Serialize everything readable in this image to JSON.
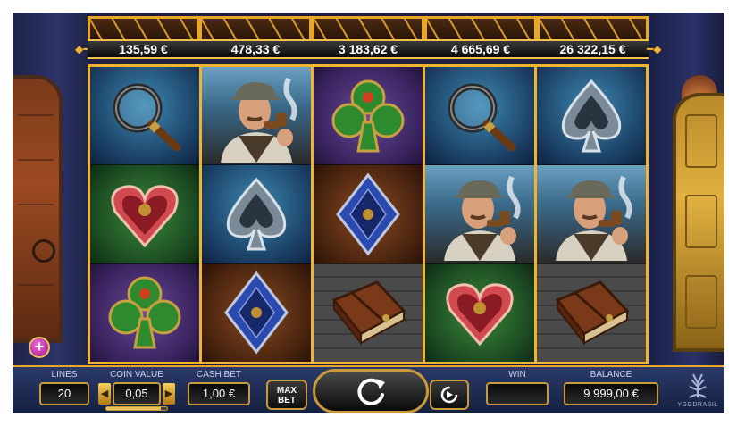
{
  "jackpots": [
    "135,59 €",
    "478,33 €",
    "3 183,62 €",
    "4 665,69 €",
    "26 322,15 €"
  ],
  "reels": [
    [
      {
        "symbol": "magnifying-glass",
        "bg": "blue"
      },
      {
        "symbol": "heart",
        "bg": "green"
      },
      {
        "symbol": "club",
        "bg": "purple"
      }
    ],
    [
      {
        "symbol": "detective",
        "bg": "street"
      },
      {
        "symbol": "spade",
        "bg": "blue"
      },
      {
        "symbol": "diamond",
        "bg": "brown"
      }
    ],
    [
      {
        "symbol": "club",
        "bg": "purple"
      },
      {
        "symbol": "diamond",
        "bg": "brown"
      },
      {
        "symbol": "book",
        "bg": "stone"
      }
    ],
    [
      {
        "symbol": "magnifying-glass",
        "bg": "blue"
      },
      {
        "symbol": "detective",
        "bg": "street"
      },
      {
        "symbol": "heart",
        "bg": "green"
      }
    ],
    [
      {
        "symbol": "spade",
        "bg": "blue"
      },
      {
        "symbol": "detective",
        "bg": "street"
      },
      {
        "symbol": "book",
        "bg": "stone"
      }
    ]
  ],
  "controls": {
    "lines_label": "LINES",
    "lines_value": "20",
    "coin_value_label": "COIN VALUE",
    "coin_value": "0,05",
    "coin_value_level": 0.9,
    "cash_bet_label": "CASH BET",
    "cash_bet": "1,00 €",
    "max_bet_label_1": "MAX",
    "max_bet_label_2": "BET",
    "win_label": "WIN",
    "win_value": "",
    "balance_label": "BALANCE",
    "balance_value": "9 999,00 €",
    "plus_label": "+",
    "brand_name": "YGGDRASIL"
  },
  "colors": {
    "frame_gold": "#f1b432",
    "bar_blue": "#1c2a52",
    "accent_magenta": "#d23cbc"
  }
}
